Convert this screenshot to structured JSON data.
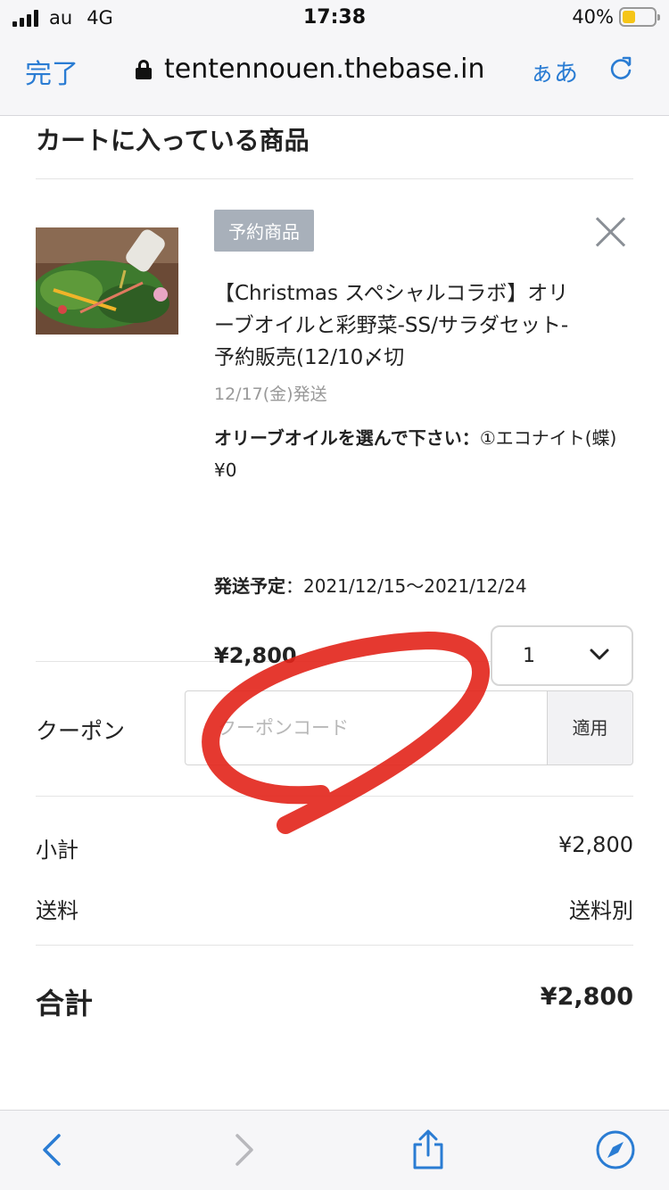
{
  "status_bar": {
    "carrier": "au",
    "network": "4G",
    "time": "17:38",
    "battery_percent": "40%",
    "battery_level": 0.4,
    "battery_color": "#f5c518"
  },
  "browser": {
    "done_label": "完了",
    "url": "tentennouen.thebase.in",
    "text_size_label": "ぁあ",
    "icons": [
      "lock-icon",
      "reload-icon",
      "back-icon",
      "forward-icon",
      "share-icon",
      "compass-icon"
    ],
    "accent_color": "#2a7cd3"
  },
  "cart": {
    "title": "カートに入っている商品",
    "item": {
      "badge": "予約商品",
      "name": "【Christmas スペシャルコラボ】オリーブオイルと彩野菜-SS/サラダセット-予約販売(12/10〆切",
      "ship_date": "12/17(金)発送",
      "option_label": "オリーブオイルを選んで下さい：",
      "option_value": "①エコナイト(蝶) ¥0",
      "schedule_label": "発送予定",
      "schedule_value": "：2021/12/15〜2021/12/24",
      "price": "¥2,800",
      "quantity": "1"
    },
    "coupon": {
      "label": "クーポン",
      "placeholder": "クーポンコード",
      "apply_label": "適用"
    },
    "summary": {
      "subtotal_label": "小計",
      "subtotal_value": "¥2,800",
      "shipping_label": "送料",
      "shipping_value": "送料別",
      "total_label": "合計",
      "total_value": "¥2,800"
    }
  },
  "annotation": {
    "color": "#e2231a"
  }
}
